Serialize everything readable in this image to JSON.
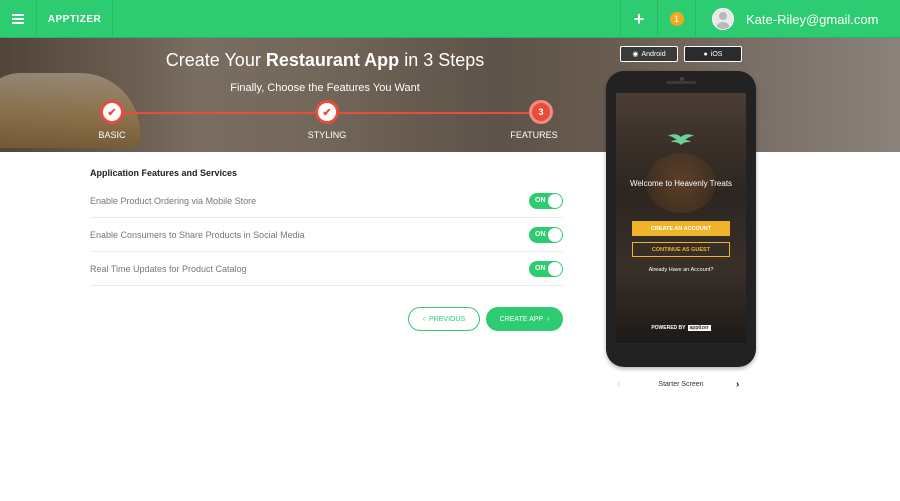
{
  "topbar": {
    "brand": "APPTIZER",
    "add_icon": "plus-icon",
    "notification_count": "1",
    "username": "Kate-Riley@gmail.com"
  },
  "hero": {
    "title_pre": "Create Your ",
    "title_bold": "Restaurant App",
    "title_post": " in 3 Steps",
    "subtitle": "Finally, Choose the Features You Want",
    "steps": [
      {
        "label": "BASIC",
        "state": "done"
      },
      {
        "label": "STYLING",
        "state": "done"
      },
      {
        "label": "FEATURES",
        "state": "active",
        "number": "3"
      }
    ],
    "accent": "#e74c3c"
  },
  "features": {
    "title": "Application Features and Services",
    "items": [
      {
        "label": "Enable Product Ordering via Mobile Store",
        "toggle": "ON"
      },
      {
        "label": "Enable Consumers to Share Products in Social Media",
        "toggle": "ON"
      },
      {
        "label": "Real Time Updates for Product Catalog",
        "toggle": "ON"
      }
    ]
  },
  "actions": {
    "previous": "PREVIOUS",
    "create": "CREATE APP"
  },
  "preview": {
    "os_tabs": [
      "Android",
      "iOS"
    ],
    "welcome": "Welcome to Heavenly Treats",
    "create_account": "CREATE AN ACCOUNT",
    "continue_guest": "CONTINUE AS GUEST",
    "have_account": "Already Have an Account?",
    "powered_by": "POWERED BY",
    "powered_brand": "apptizer",
    "screen_name": "Starter Screen"
  },
  "colors": {
    "brand": "#2ecc71",
    "badge": "#f5a623",
    "cta": "#f0b429"
  }
}
